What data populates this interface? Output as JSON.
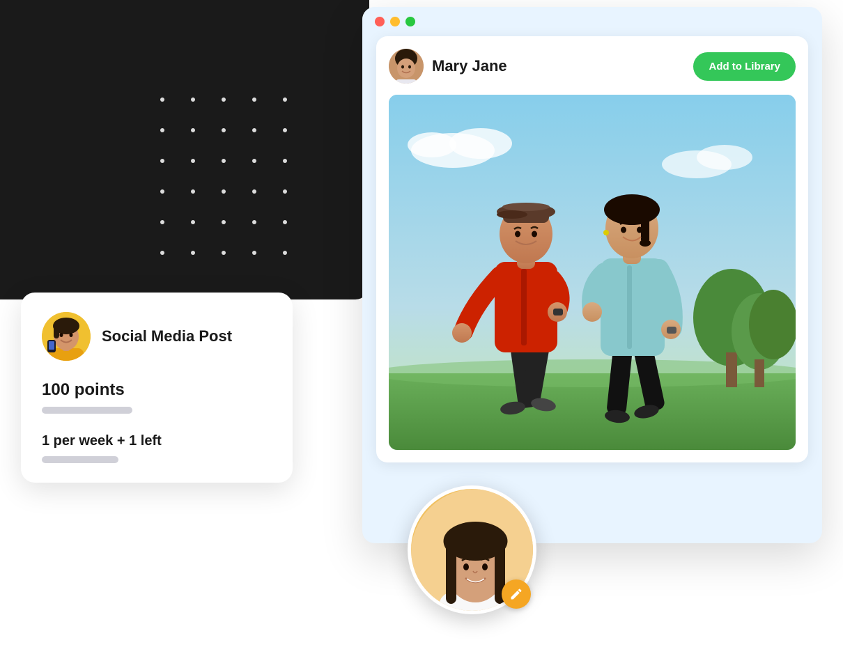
{
  "darkBg": {
    "visible": true
  },
  "browserWindow": {
    "trafficLights": [
      "red",
      "yellow",
      "green"
    ],
    "contentCard": {
      "user": {
        "name": "Mary Jane",
        "avatarAlt": "Mary Jane avatar"
      },
      "addToLibraryButton": "Add to Library",
      "postImageAlt": "Two people jogging outdoors"
    }
  },
  "socialCard": {
    "title": "Social Media Post",
    "avatarAlt": "Woman in yellow jacket",
    "points": "100 points",
    "frequency": "1 per week + 1 left"
  },
  "bottomAvatar": {
    "alt": "Profile photo of smiling woman",
    "editIconLabel": "edit"
  },
  "dotGrid": {
    "rows": 6,
    "cols": 5
  }
}
